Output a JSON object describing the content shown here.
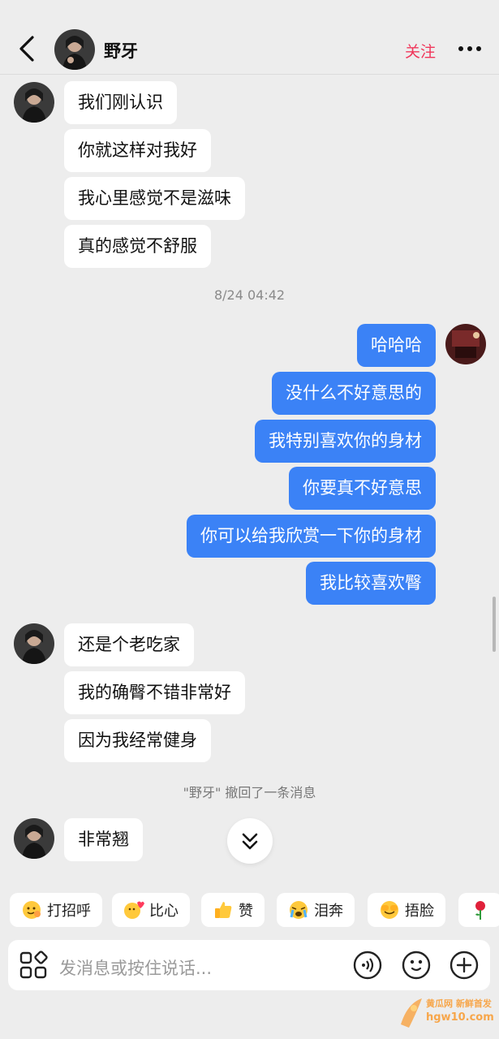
{
  "header": {
    "name": "野牙",
    "follow_label": "关注"
  },
  "messages_top": [
    {
      "text": "我们刚认识"
    },
    {
      "text": "你就这样对我好"
    },
    {
      "text": "我心里感觉不是滋味"
    },
    {
      "text": "真的感觉不舒服"
    }
  ],
  "timestamp": "8/24 04:42",
  "messages_mine": [
    {
      "text": "哈哈哈"
    },
    {
      "text": "没什么不好意思的"
    },
    {
      "text": "我特别喜欢你的身材"
    },
    {
      "text": "你要真不好意思"
    },
    {
      "text": "你可以给我欣赏一下你的身材"
    },
    {
      "text": "我比较喜欢臀"
    }
  ],
  "messages_mid": [
    {
      "text": "还是个老吃家"
    },
    {
      "text": "我的确臀不错非常好"
    },
    {
      "text": "因为我经常健身"
    }
  ],
  "system_notice": "\"野牙\" 撤回了一条消息",
  "messages_last": [
    {
      "text": "非常翘"
    }
  ],
  "quick_replies": [
    {
      "label": "打招呼",
      "icon": "wave-emoji-icon"
    },
    {
      "label": "比心",
      "icon": "finger-heart-emoji-icon"
    },
    {
      "label": "赞",
      "icon": "thumbs-up-emoji-icon"
    },
    {
      "label": "泪奔",
      "icon": "tears-emoji-icon"
    },
    {
      "label": "捂脸",
      "icon": "facepalm-emoji-icon"
    },
    {
      "label": "",
      "icon": "rose-emoji-icon"
    }
  ],
  "input": {
    "placeholder": "发消息或按住说话..."
  },
  "watermark": {
    "line1": "黄瓜网 新鲜首发",
    "line2": "hgw10.com"
  },
  "colors": {
    "accent_blue": "#3b82f6",
    "follow_red": "#f0365a",
    "background": "#ededed"
  }
}
